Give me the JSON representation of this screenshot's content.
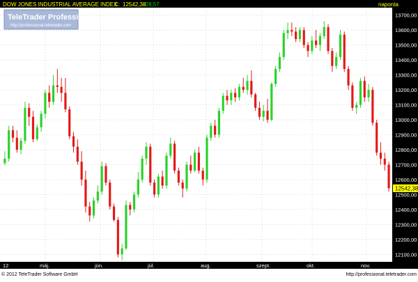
{
  "header": {
    "index_name": "DOW JONES INDUSTRIAL AVERAGE INDEX",
    "close_label": "C:",
    "close_value": "12542,38",
    "change_value": "-28,57",
    "period": "naponta"
  },
  "logo": {
    "title": "TeleTrader Professional",
    "url": "http://professional.teletrader.com"
  },
  "footer": {
    "copyright": "© 2012 TeleTrader Software GmbH",
    "url": "http://professional.teletrader.com"
  },
  "colors": {
    "up": "#2bd12b",
    "down": "#e31919",
    "header_bg": "#000000",
    "header_text": "#ffff00",
    "change_text": "#00d800",
    "axis_bg": "#000000",
    "grid": "#b8b8b8",
    "price_label_bg": "#ffff00"
  },
  "chart_data": {
    "type": "candlestick",
    "y_axis": {
      "min": 12050,
      "max": 13750,
      "ticks": [
        "12100,00",
        "12200,00",
        "12300,00",
        "12400,00",
        "12500,00",
        "12600,00",
        "12700,00",
        "12800,00",
        "12900,00",
        "13000,00",
        "13100,00",
        "13200,00",
        "13300,00",
        "13400,00",
        "13500,00",
        "13600,00",
        "13700,00"
      ],
      "last_price_label": "12542,38"
    },
    "x_axis": {
      "labels": [
        "12",
        "máj.",
        "jún.",
        "júl.",
        "aug.",
        "szept.",
        "okt.",
        "nov."
      ]
    },
    "grid": true,
    "ohlc": [
      {
        "o": 12710,
        "h": 12790,
        "l": 12695,
        "c": 12740
      },
      {
        "o": 12740,
        "h": 12960,
        "l": 12720,
        "c": 12930
      },
      {
        "o": 12930,
        "h": 12960,
        "l": 12850,
        "c": 12880
      },
      {
        "o": 12880,
        "h": 12930,
        "l": 12780,
        "c": 12800
      },
      {
        "o": 12800,
        "h": 12880,
        "l": 12770,
        "c": 12860
      },
      {
        "o": 12860,
        "h": 13120,
        "l": 12840,
        "c": 13080
      },
      {
        "o": 13080,
        "h": 13110,
        "l": 12960,
        "c": 13020
      },
      {
        "o": 13020,
        "h": 13060,
        "l": 12850,
        "c": 12870
      },
      {
        "o": 12870,
        "h": 12970,
        "l": 12860,
        "c": 12950
      },
      {
        "o": 12950,
        "h": 13060,
        "l": 12920,
        "c": 13040
      },
      {
        "o": 13040,
        "h": 13200,
        "l": 13010,
        "c": 13180
      },
      {
        "o": 13180,
        "h": 13230,
        "l": 13080,
        "c": 13120
      },
      {
        "o": 13120,
        "h": 13300,
        "l": 13100,
        "c": 13230
      },
      {
        "o": 13230,
        "h": 13340,
        "l": 13180,
        "c": 13220
      },
      {
        "o": 13220,
        "h": 13280,
        "l": 13120,
        "c": 13180
      },
      {
        "o": 13180,
        "h": 13280,
        "l": 13050,
        "c": 13070
      },
      {
        "o": 13070,
        "h": 13090,
        "l": 12870,
        "c": 12890
      },
      {
        "o": 12890,
        "h": 12920,
        "l": 12780,
        "c": 12820
      },
      {
        "o": 12820,
        "h": 12870,
        "l": 12700,
        "c": 12720
      },
      {
        "o": 12720,
        "h": 12790,
        "l": 12560,
        "c": 12600
      },
      {
        "o": 12600,
        "h": 12660,
        "l": 12380,
        "c": 12420
      },
      {
        "o": 12420,
        "h": 12450,
        "l": 12320,
        "c": 12360
      },
      {
        "o": 12360,
        "h": 12480,
        "l": 12340,
        "c": 12460
      },
      {
        "o": 12460,
        "h": 12560,
        "l": 12440,
        "c": 12520
      },
      {
        "o": 12520,
        "h": 12720,
        "l": 12500,
        "c": 12690
      },
      {
        "o": 12690,
        "h": 12710,
        "l": 12560,
        "c": 12580
      },
      {
        "o": 12580,
        "h": 12600,
        "l": 12400,
        "c": 12420
      },
      {
        "o": 12420,
        "h": 12440,
        "l": 12320,
        "c": 12330
      },
      {
        "o": 12330,
        "h": 12350,
        "l": 12080,
        "c": 12100
      },
      {
        "o": 12100,
        "h": 12170,
        "l": 12060,
        "c": 12140
      },
      {
        "o": 12140,
        "h": 12460,
        "l": 12130,
        "c": 12430
      },
      {
        "o": 12430,
        "h": 12450,
        "l": 12360,
        "c": 12400
      },
      {
        "o": 12400,
        "h": 12520,
        "l": 12380,
        "c": 12500
      },
      {
        "o": 12500,
        "h": 12650,
        "l": 12480,
        "c": 12600
      },
      {
        "o": 12600,
        "h": 12760,
        "l": 12580,
        "c": 12740
      },
      {
        "o": 12740,
        "h": 12850,
        "l": 12700,
        "c": 12820
      },
      {
        "o": 12820,
        "h": 12840,
        "l": 12560,
        "c": 12580
      },
      {
        "o": 12580,
        "h": 12600,
        "l": 12480,
        "c": 12500
      },
      {
        "o": 12500,
        "h": 12640,
        "l": 12480,
        "c": 12620
      },
      {
        "o": 12620,
        "h": 12660,
        "l": 12540,
        "c": 12560
      },
      {
        "o": 12560,
        "h": 12780,
        "l": 12540,
        "c": 12760
      },
      {
        "o": 12760,
        "h": 12880,
        "l": 12740,
        "c": 12840
      },
      {
        "o": 12840,
        "h": 12860,
        "l": 12640,
        "c": 12660
      },
      {
        "o": 12660,
        "h": 12680,
        "l": 12560,
        "c": 12580
      },
      {
        "o": 12580,
        "h": 12600,
        "l": 12480,
        "c": 12540
      },
      {
        "o": 12540,
        "h": 12720,
        "l": 12520,
        "c": 12700
      },
      {
        "o": 12700,
        "h": 12760,
        "l": 12640,
        "c": 12660
      },
      {
        "o": 12660,
        "h": 12800,
        "l": 12650,
        "c": 12780
      },
      {
        "o": 12780,
        "h": 12820,
        "l": 12640,
        "c": 12660
      },
      {
        "o": 12660,
        "h": 12680,
        "l": 12560,
        "c": 12600
      },
      {
        "o": 12600,
        "h": 12900,
        "l": 12580,
        "c": 12880
      },
      {
        "o": 12880,
        "h": 12980,
        "l": 12860,
        "c": 12960
      },
      {
        "o": 12960,
        "h": 13000,
        "l": 12880,
        "c": 12900
      },
      {
        "o": 12900,
        "h": 13080,
        "l": 12880,
        "c": 13060
      },
      {
        "o": 13060,
        "h": 13180,
        "l": 13040,
        "c": 13160
      },
      {
        "o": 13160,
        "h": 13200,
        "l": 13100,
        "c": 13130
      },
      {
        "o": 13130,
        "h": 13200,
        "l": 13100,
        "c": 13180
      },
      {
        "o": 13180,
        "h": 13210,
        "l": 13120,
        "c": 13150
      },
      {
        "o": 13150,
        "h": 13240,
        "l": 13130,
        "c": 13220
      },
      {
        "o": 13220,
        "h": 13280,
        "l": 13180,
        "c": 13200
      },
      {
        "o": 13200,
        "h": 13300,
        "l": 13170,
        "c": 13260
      },
      {
        "o": 13260,
        "h": 13330,
        "l": 13150,
        "c": 13170
      },
      {
        "o": 13170,
        "h": 13180,
        "l": 13060,
        "c": 13080
      },
      {
        "o": 13080,
        "h": 13120,
        "l": 13000,
        "c": 13020
      },
      {
        "o": 13020,
        "h": 13100,
        "l": 12990,
        "c": 13060
      },
      {
        "o": 13060,
        "h": 13140,
        "l": 12980,
        "c": 13000
      },
      {
        "o": 13000,
        "h": 13250,
        "l": 12990,
        "c": 13240
      },
      {
        "o": 13240,
        "h": 13360,
        "l": 13220,
        "c": 13340
      },
      {
        "o": 13340,
        "h": 13450,
        "l": 13320,
        "c": 13420
      },
      {
        "o": 13420,
        "h": 13600,
        "l": 13400,
        "c": 13580
      },
      {
        "o": 13580,
        "h": 13650,
        "l": 13540,
        "c": 13600
      },
      {
        "o": 13600,
        "h": 13650,
        "l": 13560,
        "c": 13590
      },
      {
        "o": 13590,
        "h": 13620,
        "l": 13520,
        "c": 13540
      },
      {
        "o": 13540,
        "h": 13620,
        "l": 13520,
        "c": 13600
      },
      {
        "o": 13600,
        "h": 13620,
        "l": 13480,
        "c": 13500
      },
      {
        "o": 13500,
        "h": 13520,
        "l": 13420,
        "c": 13460
      },
      {
        "o": 13460,
        "h": 13560,
        "l": 13440,
        "c": 13530
      },
      {
        "o": 13530,
        "h": 13600,
        "l": 13480,
        "c": 13500
      },
      {
        "o": 13500,
        "h": 13580,
        "l": 13460,
        "c": 13560
      },
      {
        "o": 13560,
        "h": 13660,
        "l": 13540,
        "c": 13620
      },
      {
        "o": 13620,
        "h": 13640,
        "l": 13440,
        "c": 13460
      },
      {
        "o": 13460,
        "h": 13480,
        "l": 13320,
        "c": 13360
      },
      {
        "o": 13360,
        "h": 13450,
        "l": 13340,
        "c": 13420
      },
      {
        "o": 13420,
        "h": 13600,
        "l": 13400,
        "c": 13570
      },
      {
        "o": 13570,
        "h": 13590,
        "l": 13320,
        "c": 13340
      },
      {
        "o": 13340,
        "h": 13360,
        "l": 13200,
        "c": 13230
      },
      {
        "o": 13230,
        "h": 13250,
        "l": 13060,
        "c": 13080
      },
      {
        "o": 13080,
        "h": 13120,
        "l": 13040,
        "c": 13100
      },
      {
        "o": 13100,
        "h": 13280,
        "l": 13080,
        "c": 13260
      },
      {
        "o": 13260,
        "h": 13290,
        "l": 13120,
        "c": 13150
      },
      {
        "o": 13150,
        "h": 13240,
        "l": 13120,
        "c": 13200
      },
      {
        "o": 13200,
        "h": 13220,
        "l": 12960,
        "c": 12980
      },
      {
        "o": 12980,
        "h": 13000,
        "l": 12760,
        "c": 12780
      },
      {
        "o": 12780,
        "h": 12850,
        "l": 12700,
        "c": 12740
      },
      {
        "o": 12740,
        "h": 12780,
        "l": 12660,
        "c": 12700
      },
      {
        "o": 12700,
        "h": 12720,
        "l": 12520,
        "c": 12542
      }
    ]
  }
}
